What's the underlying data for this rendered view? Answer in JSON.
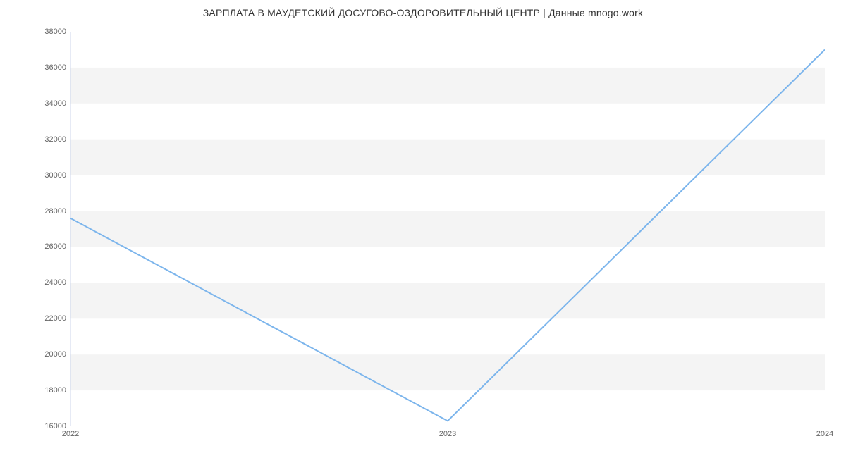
{
  "chart_data": {
    "type": "line",
    "title": "ЗАРПЛАТА В МАУДЕТСКИЙ ДОСУГОВО-ОЗДОРОВИТЕЛЬНЫЙ ЦЕНТР | Данные mnogo.work",
    "x": [
      "2022",
      "2023",
      "2024"
    ],
    "values": [
      27600,
      16300,
      37000
    ],
    "xlabel": "",
    "ylabel": "",
    "ylim": [
      16000,
      38000
    ],
    "yticks": [
      16000,
      18000,
      20000,
      22000,
      24000,
      26000,
      28000,
      30000,
      32000,
      34000,
      36000,
      38000
    ],
    "line_color": "#7cb5ec",
    "grid_band_color": "#f4f4f4"
  }
}
